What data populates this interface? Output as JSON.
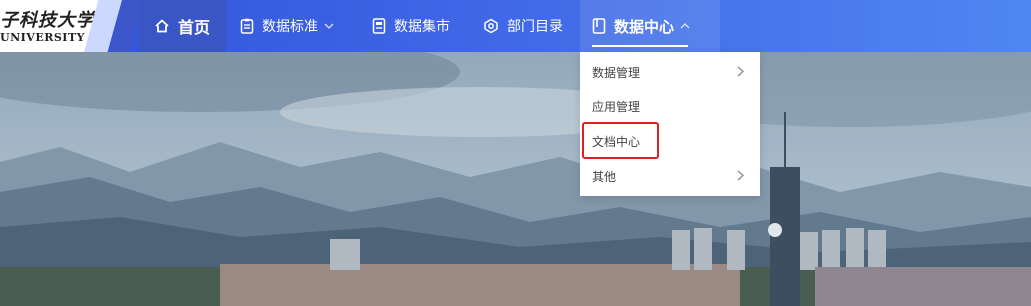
{
  "logo": {
    "cn_text": "子科技大学",
    "en_text": "UNIVERSITY"
  },
  "nav": {
    "home": {
      "label": "首页",
      "icon": "home-icon"
    },
    "standard": {
      "label": "数据标准",
      "icon": "clipboard-icon"
    },
    "market": {
      "label": "数据集市",
      "icon": "document-icon"
    },
    "dept": {
      "label": "部门目录",
      "icon": "network-icon"
    },
    "center": {
      "label": "数据中心",
      "icon": "book-icon",
      "expanded": true
    }
  },
  "dropdown": {
    "items": [
      {
        "label": "数据管理",
        "has_submenu": true
      },
      {
        "label": "应用管理",
        "has_submenu": false
      },
      {
        "label": "文档中心",
        "has_submenu": false,
        "highlighted": true
      },
      {
        "label": "其他",
        "has_submenu": true
      }
    ]
  },
  "colors": {
    "nav_gradient_start": "#2f52d6",
    "nav_gradient_end": "#4f86f1",
    "highlight_border": "#e02020"
  }
}
